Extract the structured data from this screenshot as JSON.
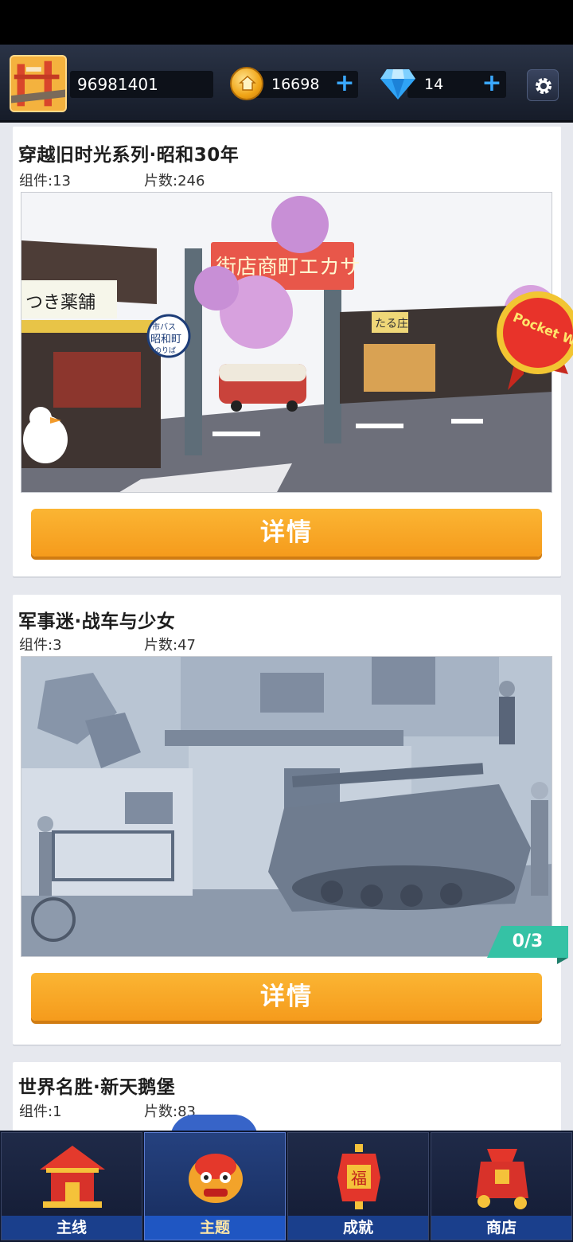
{
  "header": {
    "user_id": "96981401",
    "coins": "16698",
    "gems": "14",
    "plus_label": "+"
  },
  "cards": [
    {
      "title": "穿越旧时光系列·昭和30年",
      "components_label": "组件:13",
      "pieces_label": "片数:246",
      "button_label": "详情",
      "badge_text": "Pocket World",
      "scene_signs": [
        "つき薬舗",
        "街店商町エカサ",
        "昭和町",
        "市バス",
        "のりば",
        "たる庄"
      ]
    },
    {
      "title": "军事迷·战车与少女",
      "components_label": "组件:3",
      "pieces_label": "片数:47",
      "button_label": "详情",
      "progress": "0/3"
    },
    {
      "title": "世界名胜·新天鹅堡",
      "components_label": "组件:1",
      "pieces_label": "片数:83"
    }
  ],
  "tabs": [
    {
      "label": "主线",
      "icon": "temple-icon",
      "active": false
    },
    {
      "label": "主题",
      "icon": "lion-dance-icon",
      "active": true
    },
    {
      "label": "成就",
      "icon": "fu-lantern-icon",
      "active": false
    },
    {
      "label": "商店",
      "icon": "gift-bag-icon",
      "active": false
    }
  ],
  "colors": {
    "accent_orange": "#f7a627",
    "progress_teal": "#35c2a5",
    "plus_blue": "#3aa8ff",
    "tab_active": "#1f56c2"
  }
}
